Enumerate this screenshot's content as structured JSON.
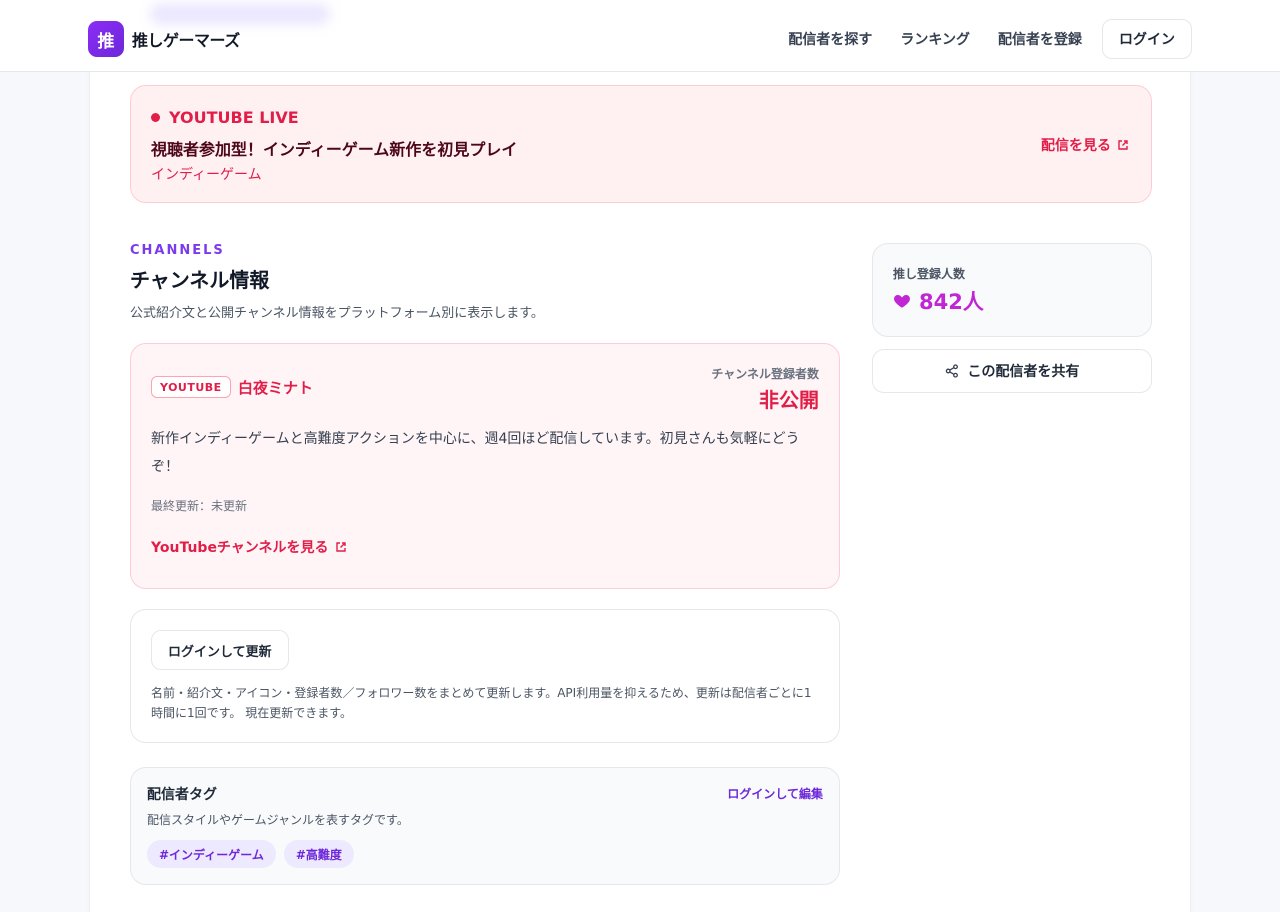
{
  "header": {
    "logo_char": "推",
    "brand": "推しゲーマーズ",
    "nav": [
      "配信者を探す",
      "ランキング",
      "配信者を登録"
    ],
    "login": "ログイン"
  },
  "live": {
    "badge": "YOUTUBE LIVE",
    "title": "視聴者参加型！インディーゲーム新作を初見プレイ",
    "genre": "インディーゲーム",
    "watch": "配信を見る"
  },
  "channels": {
    "eyebrow": "CHANNELS",
    "title": "チャンネル情報",
    "description": "公式紹介文と公開チャンネル情報をプラットフォーム別に表示します。",
    "card": {
      "platform": "YOUTUBE",
      "name": "白夜ミナト",
      "subscribers_label": "チャンネル登録者数",
      "subscribers_value": "非公開",
      "description": "新作インディーゲームと高難度アクションを中心に、週4回ほど配信しています。初見さんも気軽にどうぞ！",
      "updated": "最終更新：未更新",
      "link": "YouTubeチャンネルを見る"
    }
  },
  "refresh": {
    "button": "ログインして更新",
    "note": "名前・紹介文・アイコン・登録者数／フォロワー数をまとめて更新します。API利用量を抑えるため、更新は配信者ごとに1時間に1回です。 現在更新できます。"
  },
  "tags": {
    "title": "配信者タグ",
    "edit": "ログインして編集",
    "description": "配信スタイルやゲームジャンルを表すタグです。",
    "items": [
      "#インディーゲーム",
      "#高難度"
    ]
  },
  "sidebar": {
    "oshi_label": "推し登録人数",
    "oshi_count": "842人",
    "share": "この配信者を共有"
  },
  "colors": {
    "accent_purple": "#7c3aed",
    "live_red": "#e11d48",
    "oshi_magenta": "#c026d3"
  },
  "icons": {
    "external": "external-link-icon",
    "heart": "heart-icon",
    "share": "share-icon"
  }
}
